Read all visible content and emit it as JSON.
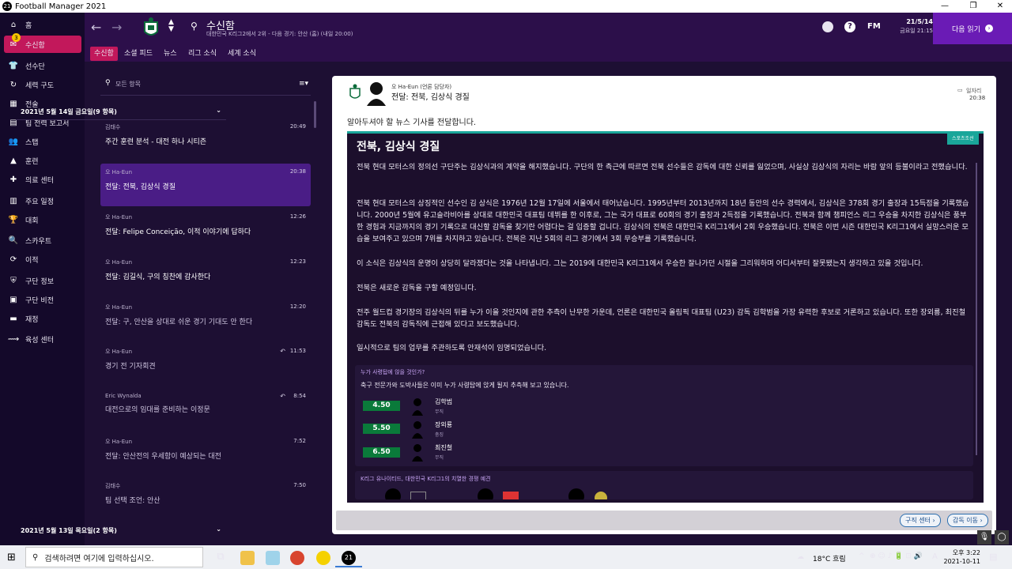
{
  "window": {
    "title": "Football Manager 2021"
  },
  "sidebar": {
    "items": [
      {
        "label": "홈",
        "icon": "home-icon"
      },
      {
        "label": "수신함",
        "icon": "inbox-icon",
        "badge": "3"
      },
      {
        "label": "선수단",
        "icon": "squad-icon"
      },
      {
        "label": "세력 구도",
        "icon": "dynamics-icon"
      },
      {
        "label": "전술",
        "icon": "tactics-icon"
      },
      {
        "label": "팀 전력 보고서",
        "icon": "report-icon"
      },
      {
        "label": "스탭",
        "icon": "staff-icon"
      },
      {
        "label": "훈련",
        "icon": "training-icon"
      },
      {
        "label": "의료 센터",
        "icon": "medical-icon"
      },
      {
        "label": "주요 일정",
        "icon": "calendar-icon"
      },
      {
        "label": "대회",
        "icon": "trophy-icon"
      },
      {
        "label": "스카우트",
        "icon": "scout-icon"
      },
      {
        "label": "이적",
        "icon": "transfer-icon"
      },
      {
        "label": "구단 정보",
        "icon": "club-info-icon"
      },
      {
        "label": "구단 비전",
        "icon": "vision-icon"
      },
      {
        "label": "재정",
        "icon": "finance-icon"
      },
      {
        "label": "육성 센터",
        "icon": "development-icon"
      }
    ]
  },
  "header": {
    "page_title": "수신함",
    "subtitle": "대한민국 K리그2에서 2위 - 다음 경기: 안산 (홈) (내일 20:00)",
    "fm_label": "FM",
    "date": "21/5/14",
    "weekday_time": "금요일 21:15",
    "continue_label": "다음 읽기"
  },
  "tabs": [
    "수신함",
    "소셜 피드",
    "뉴스",
    "리그 소식",
    "세계 소식"
  ],
  "list": {
    "filter_placeholder": "모든 항목",
    "group1": "2021년 5월 14일 금요일(9 항목)",
    "group2": "2021년 5월 13일 목요일(2 항목)",
    "messages": [
      {
        "from": "김태수",
        "subject": "주간 훈련 분석 - 대전 하나 시티즌",
        "time": "20:49"
      },
      {
        "from": "오 Ha-Eun",
        "subject": "전달: 전북, 김상식 경질",
        "time": "20:38"
      },
      {
        "from": "오 Ha-Eun",
        "subject": "전달: Felipe Conceição, 이적 이야기에 답하다",
        "time": "12:26"
      },
      {
        "from": "오 Ha-Eun",
        "subject": "전달: 김길식, 구의 칭찬에 감사한다",
        "time": "12:23"
      },
      {
        "from": "오 Ha-Eun",
        "subject": "전달: 구, 안산을 상대로 쉬운 경기 기대도 안 한다",
        "time": "12:20"
      },
      {
        "from": "오 Ha-Eun",
        "subject": "경기 전 기자회견",
        "time": "11:53"
      },
      {
        "from": "Eric Wynalda",
        "subject": "대전으로의 임대를 준비하는 이정문",
        "time": "8:54"
      },
      {
        "from": "오 Ha-Eun",
        "subject": "전달: 안산전의 우세함이 예상되는 대전",
        "time": "7:52"
      },
      {
        "from": "김태수",
        "subject": "팀 선택 조언: 안산",
        "time": "7:50"
      }
    ]
  },
  "article": {
    "sender": "오 Ha-Eun (언론 담당자)",
    "subject": "전달: 전북, 김상식 경질",
    "archive_label": "일자리",
    "time": "20:38",
    "intro": "알아두셔야 할 뉴스 기사를 전달합니다.",
    "source": "스포츠조선",
    "headline": "전북, 김상식 경질",
    "paragraphs": [
      "전북 현대 모터스의 정의선 구단주는 김상식과의 계약을 해지했습니다. 구단의 한 측근에 따르면 전북 선수들은 감독에 대한 신뢰를 잃었으며, 사실상 김상식의 자리는 바람 앞의 등불이라고 전했습니다.",
      "전북 현대 모터스의 상징적인 선수인 김 상식은 1976년 12월 17일에 서울에서 태어났습니다. 1995년부터 2013년까지 18년 동안의 선수 경력에서, 김상식은 378회 경기 출장과 15득점을 기록했습니다. 2000년 5월에 유고슬라비아를 상대로 대한민국 대표팀 데뷔를 한 이후로, 그는 국가 대표로 60회의 경기 출장과 2득점을 기록했습니다. 전북과 함께 챔피언스 리그 우승을 차지한 김상식은 풍부한 경험과 지금까지의 경기 기록으로 대신할 감독을 찾기란 어렵다는 걸 입증할 겁니다. 김상식의 전북은 대한민국 K리그1에서 2회 우승했습니다. 전북은 이번 시즌 대한민국 K리그1에서 실망스러운 모습을 보여주고 있으며 7위를 차지하고 있습니다. 전북은 지난 5회의 리그 경기에서 3회 무승부를 기록했습니다.",
      "이 소식은 김상식의 운명이 상당히 달라졌다는 것을 나타냅니다. 그는 2019에 대한민국 K리그1에서 우승한 잘나가던 시절을 그리워하며 어디서부터 잘못됐는지 생각하고 있을 것입니다.",
      "전북은 새로운 감독을 구할 예정입니다.",
      "전주 월드컵 경기장의 김상식의 뒤를 누가 이을 것인지에 관한 추측이 난무한 가운데, 언론은 대한민국 올림픽 대표팀 (U23) 감독 김학범을 가장 유력한 후보로 거론하고 있습니다.  또한 장외룡, 최진철 감독도 전북의 감독직에 근접해 있다고 보도했습니다.",
      "일시적으로 팀의 업무를 주관하도록 안재석이 임명되었습니다."
    ],
    "odds_title": "누가 사령탑에 앉을 것인가?",
    "odds_desc": "축구 전문가와 도박사들은 이미 누가 사령탑에 앉게 될지 추측해 보고 있습니다.",
    "candidates": [
      {
        "odds": "4.50",
        "name": "김학범",
        "status": "무직"
      },
      {
        "odds": "5.50",
        "name": "장외룡",
        "status": "충징"
      },
      {
        "odds": "6.50",
        "name": "최진철",
        "status": "무직"
      }
    ],
    "related_title": "K리그 유나이티드, 대한민국 K리그1의 치열한 경쟁 예견",
    "buttons": {
      "job_centre": "구직 센터",
      "go_team": "감독 이동"
    }
  },
  "taskbar": {
    "search_placeholder": "검색하려면 여기에 입력하십시오.",
    "weather": "18°C 흐림",
    "ime": "A",
    "time": "오후 3:22",
    "date": "2021-10-11"
  },
  "colors": {
    "accent": "#c2185b",
    "header": "#2c0f4a",
    "sidebar": "#14092a",
    "continue": "#6a1bb5",
    "odds": "#0a7a3a",
    "source_tab": "#1aa69a"
  }
}
